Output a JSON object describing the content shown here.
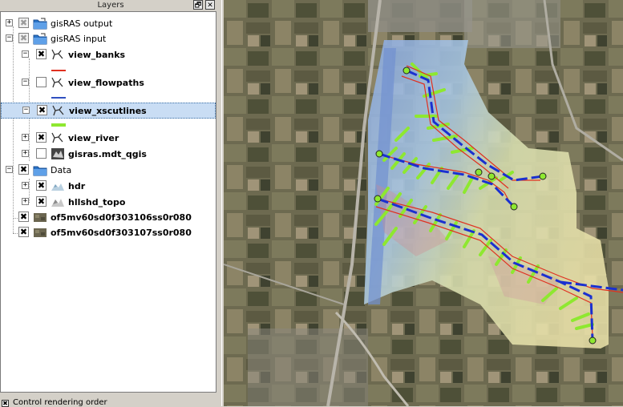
{
  "panel": {
    "title": "Layers",
    "float_button": "🗗",
    "close_button": "✕"
  },
  "layers": [
    {
      "label": "gisRAS output",
      "type": "group",
      "expanded": false,
      "checked": "partial"
    },
    {
      "label": "gisRAS input",
      "type": "group",
      "expanded": true,
      "checked": "partial"
    },
    {
      "label": "view_banks",
      "type": "layer",
      "expanded": true,
      "checked": true,
      "symbol_color": "#e03020"
    },
    {
      "label": "view_flowpaths",
      "type": "layer",
      "expanded": true,
      "checked": false,
      "symbol_color": "#3050c0"
    },
    {
      "label": "view_xscutlines",
      "type": "layer",
      "expanded": true,
      "checked": true,
      "selected": true,
      "symbol_color": "#8ee830"
    },
    {
      "label": "view_river",
      "type": "layer",
      "expanded": false,
      "checked": true
    },
    {
      "label": "gisras.mdt_qgis",
      "type": "raster",
      "expanded": false,
      "checked": false
    },
    {
      "label": "Data",
      "type": "group",
      "expanded": true,
      "checked": true
    },
    {
      "label": "hdr",
      "type": "raster",
      "expanded": false,
      "checked": true
    },
    {
      "label": "hllshd_topo",
      "type": "raster",
      "expanded": false,
      "checked": true
    },
    {
      "label": "of5mv60sd0f303106ss0r080",
      "type": "raster",
      "checked": true
    },
    {
      "label": "of5mv60sd0f303107ss0r080",
      "type": "raster",
      "checked": true
    }
  ],
  "bottom": {
    "control_rendering_label": "Control rendering order",
    "checked": true
  },
  "icons": {
    "expand": "plus-box-icon",
    "collapse": "minus-box-icon",
    "group": "folder-icon",
    "vector": "vector-layer-icon",
    "raster": "raster-layer-icon"
  },
  "colors": {
    "selection": "#c9ddf4",
    "banks": "#e03020",
    "flowpaths": "#3050c0",
    "xscutlines": "#8ee830",
    "river": "#1a30d0"
  }
}
